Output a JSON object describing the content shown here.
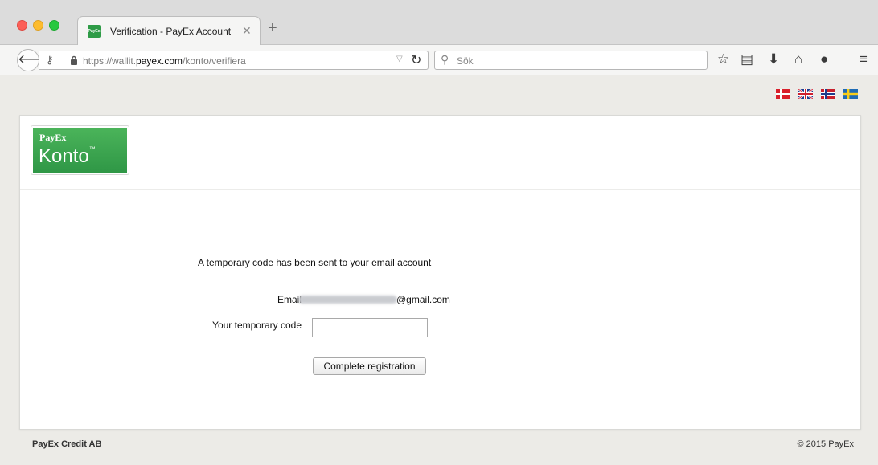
{
  "browser": {
    "tab_title": "Verification - PayEx Account",
    "tab_favicon_text": "PayEx",
    "url_prefix": "https://wallit.",
    "url_domain": "payex.com",
    "url_path": "/konto/verifiera",
    "search_placeholder": "Sök",
    "icons": [
      "back-arrow-icon",
      "key-icon",
      "lock-icon",
      "reload-icon",
      "search-icon",
      "bookmark-star-icon",
      "reading-list-icon",
      "download-icon",
      "home-icon",
      "chat-icon",
      "hamburger-menu-icon"
    ]
  },
  "languages": [
    "Danish",
    "English",
    "Norwegian",
    "Swedish"
  ],
  "logo": {
    "brand": "PayEx",
    "product": "Konto",
    "tm": "™"
  },
  "form": {
    "intro": "A temporary code has been sent to your email account",
    "email_label": "Email",
    "email_domain": "@gmail.com",
    "code_label": "Your temporary code",
    "code_value": "",
    "submit_label": "Complete registration"
  },
  "footer": {
    "company": "PayEx Credit AB",
    "copyright": "© 2015 PayEx"
  },
  "colors": {
    "brand_green": "#2f9746",
    "page_background": "#ecebe7"
  }
}
